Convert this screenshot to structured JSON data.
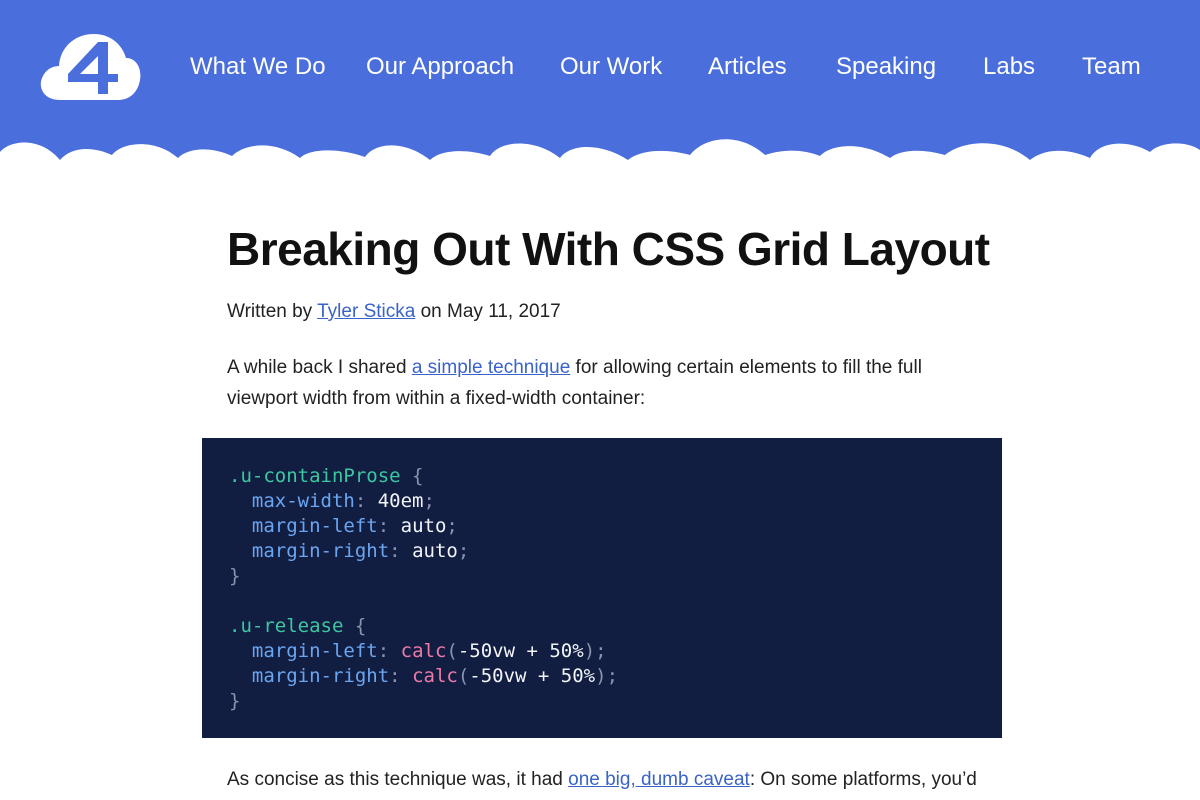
{
  "nav": {
    "items": [
      "What We Do",
      "Our Approach",
      "Our Work",
      "Articles",
      "Speaking",
      "Labs",
      "Team"
    ]
  },
  "colors": {
    "header_blue": "#4a6edb",
    "link_blue": "#3a63c9",
    "code_background": "#121d42"
  },
  "icons": {
    "logo": "cloud-four-logo"
  },
  "article": {
    "title": "Breaking Out With CSS Grid Layout",
    "byline_prefix": "Written by ",
    "author": "Tyler Sticka",
    "byline_middle": " on ",
    "date": "May 11, 2017",
    "p1_before": "A while back I shared ",
    "p1_link": "a simple technique",
    "p1_after": " for allowing certain elements to fill the full viewport width from within a fixed-width container:",
    "p2_before": "As concise as this technique was, it had ",
    "p2_link": "one big, dumb caveat",
    "p2_after": ": On some platforms, you’d"
  },
  "code": {
    "sel1": ".u-containProse",
    "brace_open": " {",
    "brace_close": "}",
    "prop_max_width": "max-width",
    "val_40em": "40em",
    "prop_margin_left": "margin-left",
    "prop_margin_right": "margin-right",
    "val_auto": "auto",
    "colon": ": ",
    "semicolon": ";",
    "sel2": ".u-release",
    "fn_calc": "calc",
    "paren_open": "(",
    "calc_args": "-50vw + 50%",
    "paren_close": ")"
  }
}
